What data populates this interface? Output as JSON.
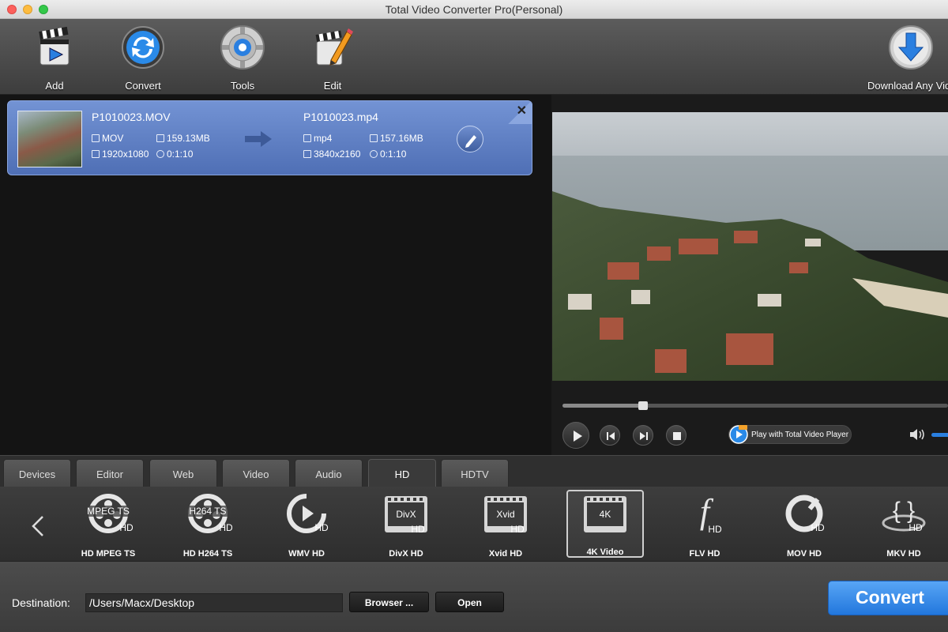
{
  "window": {
    "title": "Total Video Converter Pro(Personal)"
  },
  "toolbar": {
    "add": "Add",
    "convert": "Convert",
    "tools": "Tools",
    "edit": "Edit",
    "download": "Download Any Vid"
  },
  "file": {
    "source_name": "P1010023.MOV",
    "source_format": "MOV",
    "source_size": "159.13MB",
    "source_resolution": "1920x1080",
    "source_duration": "0:1:10",
    "target_name": "P1010023.mp4",
    "target_format": "mp4",
    "target_size": "157.16MB",
    "target_resolution": "3840x2160",
    "target_duration": "0:1:10"
  },
  "player": {
    "play_with": "Play with Total Video Player",
    "progress": 0.21
  },
  "tabs": [
    "Devices",
    "Editor",
    "Web",
    "Video",
    "Audio",
    "HD",
    "HDTV"
  ],
  "active_tab": "HD",
  "formats": [
    {
      "label": "HD MPEG TS",
      "icon": "MPEG TS",
      "badge": "HD"
    },
    {
      "label": "HD H264 TS",
      "icon": "H264 TS",
      "badge": "HD"
    },
    {
      "label": "WMV HD",
      "icon": "",
      "badge": "HD"
    },
    {
      "label": "DivX HD",
      "icon": "DivX",
      "badge": "HD"
    },
    {
      "label": "Xvid HD",
      "icon": "Xvid",
      "badge": "HD"
    },
    {
      "label": "4K Video",
      "icon": "4K",
      "badge": ""
    },
    {
      "label": "FLV HD",
      "icon": "f",
      "badge": "HD"
    },
    {
      "label": "MOV HD",
      "icon": "",
      "badge": "HD"
    },
    {
      "label": "MKV HD",
      "icon": "{ }",
      "badge": "HD"
    }
  ],
  "selected_format": "4K Video",
  "destination": {
    "label": "Destination:",
    "path": "/Users/Macx/Desktop",
    "browse": "Browser ...",
    "open": "Open"
  },
  "convert_button": "Convert",
  "colors": {
    "accent": "#2f7fe0",
    "item_bg": "#5f7fc4"
  }
}
